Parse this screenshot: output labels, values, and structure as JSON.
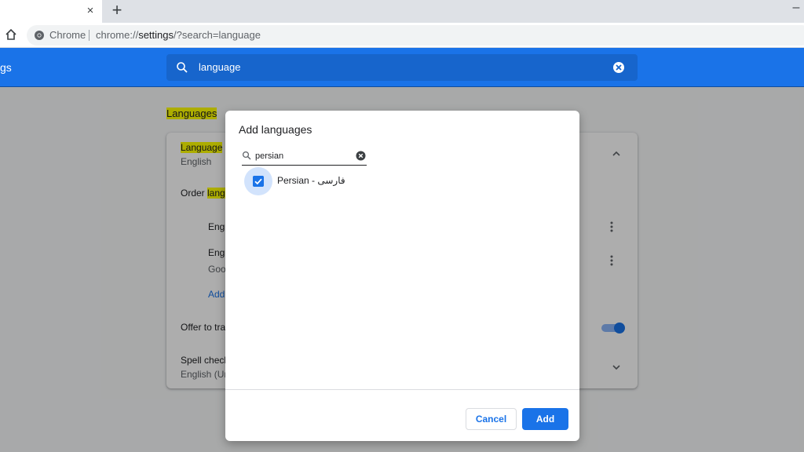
{
  "browser": {
    "tab_close": "×",
    "new_tab": "+",
    "minimize": "–",
    "site_chip": "Chrome",
    "url_prefix": "chrome://",
    "url_host": "settings",
    "url_path": "/?search=language"
  },
  "settings": {
    "header_title": "gs",
    "search_value": "language",
    "section_title_highlight": "Languages",
    "rows": {
      "language_label_hl": "Language",
      "language_value": "English",
      "order_prefix": "Order ",
      "order_hl": "langu",
      "lang1": "Engl",
      "lang2": "Engl",
      "lang2_sub": "Goo",
      "add_link": "Add",
      "offer_translate": "Offer to tra",
      "spell_check": "Spell check",
      "spell_check_sub": "English (Un"
    }
  },
  "dialog": {
    "title": "Add languages",
    "search_value": "persian",
    "results": [
      {
        "label": "Persian - فارسی",
        "checked": true
      }
    ],
    "cancel_label": "Cancel",
    "add_label": "Add"
  },
  "colors": {
    "accent": "#1a73e8",
    "highlight": "#ffff00"
  }
}
